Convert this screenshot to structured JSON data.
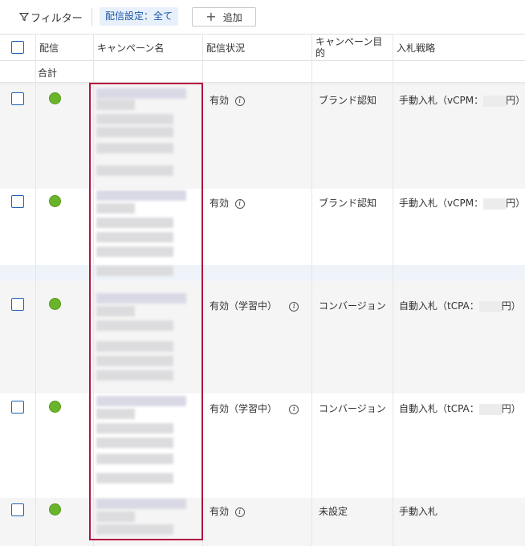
{
  "toolbar": {
    "filter_label": "フィルター",
    "filter_chip": "配信設定：全て",
    "add_label": "追加"
  },
  "columns": [
    "配信",
    "キャンペーン名",
    "配信状況",
    "キャンペーン目的",
    "入札戦略"
  ],
  "total_label": "合計",
  "rows": [
    {
      "status": "有効",
      "objective": "ブランド認知",
      "bid_prefix": "手動入札（vCPM：",
      "bid_suffix": "円）",
      "status_color": "#69b42a"
    },
    {
      "status": "有効",
      "objective": "ブランド認知",
      "bid_prefix": "手動入札（vCPM：",
      "bid_suffix": "円）",
      "status_color": "#69b42a"
    },
    {
      "status": "有効（学習中）",
      "objective": "コンバージョン",
      "bid_prefix": "自動入札（tCPA：",
      "bid_suffix": "円）",
      "status_color": "#69b42a"
    },
    {
      "status": "有効（学習中）",
      "objective": "コンバージョン",
      "bid_prefix": "自動入札（tCPA：",
      "bid_suffix": "円）",
      "status_color": "#69b42a"
    },
    {
      "status": "有効",
      "objective": "未設定",
      "bid_prefix": "手動入札",
      "bid_suffix": "",
      "status_color": "#69b42a"
    }
  ]
}
